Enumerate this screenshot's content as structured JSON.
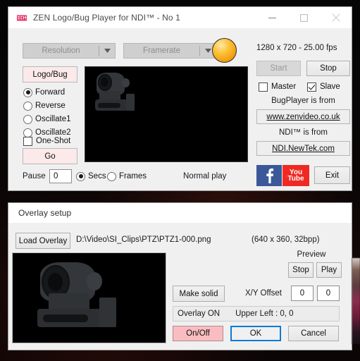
{
  "player_window": {
    "title": "ZEN Logo/Bug Player for NDI™ - No 1",
    "icon": "zen-logo-icon",
    "controls": {
      "minimize": "minimize-icon",
      "maximize": "maximize-icon",
      "close": "close-icon"
    },
    "resolution_combo": {
      "label": "Resolution",
      "arrow": "▼"
    },
    "framerate_combo": {
      "label": "Framerate",
      "arrow": "▼"
    },
    "lamp": {
      "name": "status-lamp",
      "color": "#f5a81c"
    },
    "logo_bug_button": "Logo/Bug",
    "direction_options": [
      {
        "label": "Forward",
        "selected": true
      },
      {
        "label": "Reverse",
        "selected": false
      },
      {
        "label": "Oscillate1",
        "selected": false
      },
      {
        "label": "Oscillate2",
        "selected": false
      }
    ],
    "one_shot": {
      "label": "One-Shot",
      "checked": false
    },
    "go_button": "Go",
    "pause": {
      "label": "Pause",
      "value": "0"
    },
    "pause_units": [
      {
        "label": "Secs",
        "selected": true
      },
      {
        "label": "Frames",
        "selected": false
      }
    ],
    "play_state": "Normal play",
    "format_line": "1280 x 720 - 25.00 fps",
    "start_button": {
      "label": "Start",
      "enabled": false
    },
    "stop_button": {
      "label": "Stop",
      "enabled": true
    },
    "master": {
      "label": "Master",
      "checked": false
    },
    "slave": {
      "label": "Slave",
      "checked": true
    },
    "credit_1": "BugPlayer is from",
    "link_1": "www.zenvideo.co.uk",
    "credit_2": "NDI™ is from",
    "link_2": "NDI.NewTek.com",
    "facebook": {
      "name": "facebook-icon",
      "glyph": "f",
      "color": "#3b5998"
    },
    "youtube": {
      "name": "youtube-icon",
      "line1": "You",
      "line2": "Tube",
      "color": "#ef2a23"
    },
    "exit_button": "Exit"
  },
  "overlay_window": {
    "title": "Overlay setup",
    "load_button": "Load Overlay",
    "file_path": "D:\\Video\\SI_Clips\\PTZ\\PTZ1-000.png",
    "image_info": "(640 x 360, 32bpp)",
    "preview_label": "Preview",
    "preview_stop": "Stop",
    "preview_play": "Play",
    "make_solid_button": "Make solid",
    "xy_offset_label": "X/Y Offset",
    "x_offset": "0",
    "y_offset": "0",
    "overlay_state": "Overlay ON",
    "upper_left": "Upper Left : 0, 0",
    "onoff_button": "On/Off",
    "ok_button": "OK",
    "cancel_button": "Cancel",
    "accent_color": "#0a7bd6",
    "onoff_color": "#f9bdc1"
  }
}
